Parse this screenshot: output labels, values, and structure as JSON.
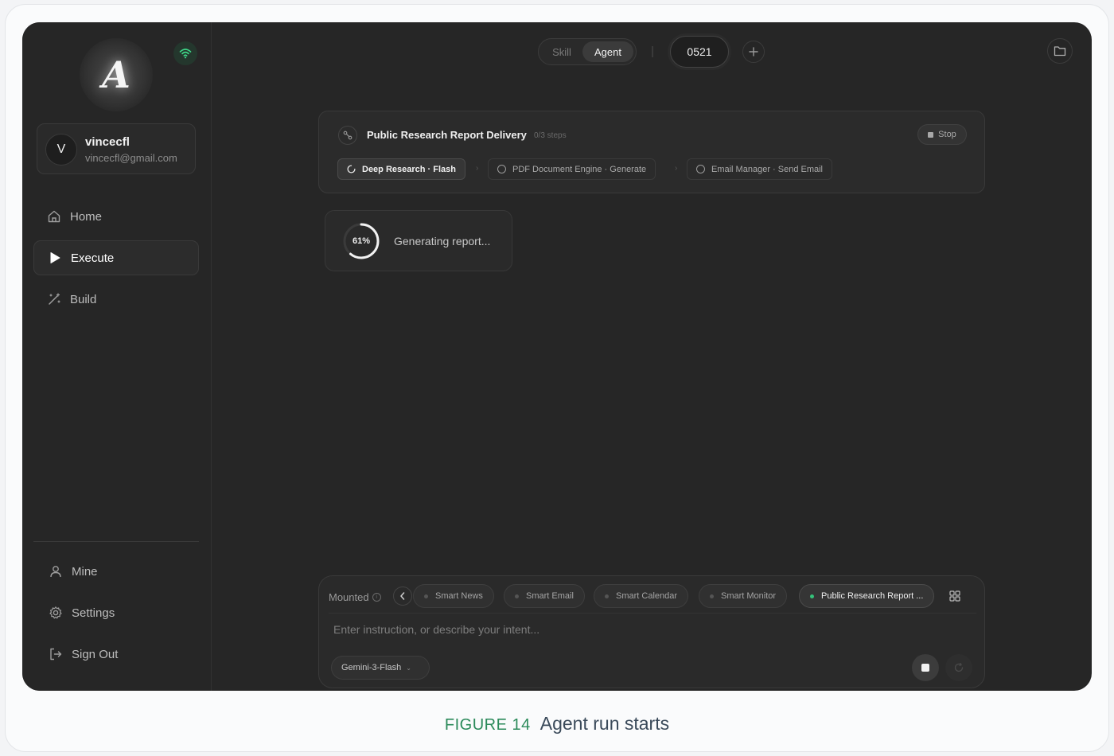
{
  "sidebar": {
    "logo_letter": "A",
    "user": {
      "initial": "V",
      "name": "vincecfl",
      "email": "vincecfl@gmail.com"
    },
    "nav": [
      {
        "label": "Home",
        "icon": "home-icon"
      },
      {
        "label": "Execute",
        "icon": "play-icon",
        "active": true
      },
      {
        "label": "Build",
        "icon": "magic-wand-icon"
      }
    ],
    "bottom_nav": [
      {
        "label": "Mine",
        "icon": "user-icon"
      },
      {
        "label": "Settings",
        "icon": "gear-icon"
      },
      {
        "label": "Sign Out",
        "icon": "sign-out-icon"
      }
    ]
  },
  "topbar": {
    "modes": [
      "Skill",
      "Agent"
    ],
    "active_mode": "Agent",
    "session_id": "0521"
  },
  "workflow": {
    "title": "Public Research Report Delivery",
    "steps_status": "0/3 steps",
    "stop_label": "Stop",
    "steps": [
      {
        "label": "Deep Research · Flash",
        "active": true
      },
      {
        "label": "PDF Document Engine · Generate",
        "active": false
      },
      {
        "label": "Email Manager · Send Email",
        "active": false
      }
    ]
  },
  "progress": {
    "percent": 61,
    "percent_label": "61%",
    "label": "Generating report..."
  },
  "composer": {
    "mounted_label": "Mounted",
    "agents": [
      {
        "label": "Smart News",
        "active": false
      },
      {
        "label": "Smart Email",
        "active": false
      },
      {
        "label": "Smart Calendar",
        "active": false
      },
      {
        "label": "Smart Monitor",
        "active": false
      },
      {
        "label": "Public Research Report ...",
        "active": true
      }
    ],
    "placeholder": "Enter instruction, or describe your intent...",
    "model": "Gemini-3-Flash"
  },
  "caption": {
    "figure": "FIGURE 14",
    "text": "Agent run starts"
  },
  "colors": {
    "app_background": "#262626",
    "active_dot": "#35c27a",
    "wifi_green": "#3fd889",
    "caption_figure": "#2b8a5a"
  }
}
